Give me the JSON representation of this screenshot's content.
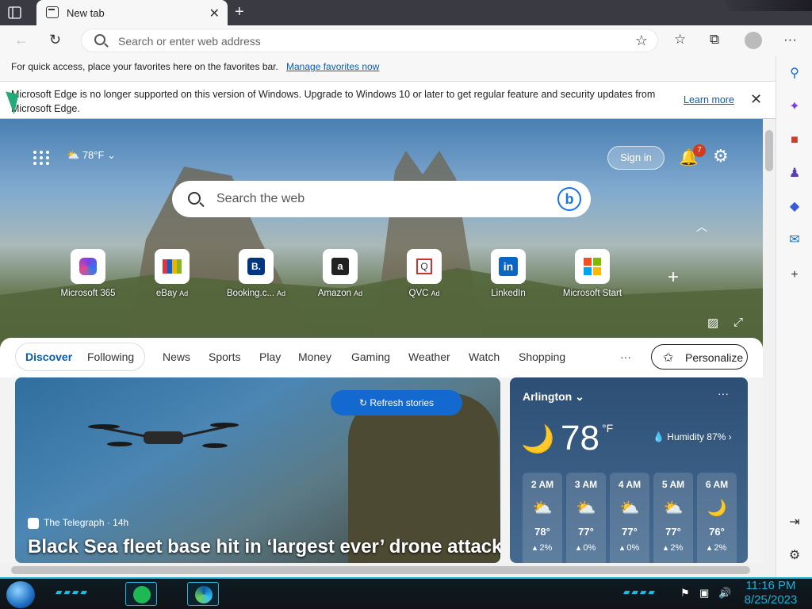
{
  "browser": {
    "tab_title": "New tab",
    "tab_close": "✕",
    "new_tab": "+",
    "address_placeholder": "Search or enter web address"
  },
  "favbar": {
    "text": "For quick access, place your favorites here on the favorites bar.",
    "link": "Manage favorites now"
  },
  "banner": {
    "message": "Microsoft Edge is no longer supported on this version of Windows. Upgrade to Windows 10 or later to get regular feature and security updates from Microsoft Edge.",
    "link": "Learn more"
  },
  "newtab": {
    "weather_small": "78°F",
    "signin": "Sign in",
    "notif_count": "7",
    "search_placeholder": "Search the web",
    "quicklinks": [
      {
        "label": "Microsoft 365",
        "ad": ""
      },
      {
        "label": "eBay",
        "ad": "Ad"
      },
      {
        "label": "Booking.c...",
        "ad": "Ad"
      },
      {
        "label": "Amazon",
        "ad": "Ad"
      },
      {
        "label": "QVC",
        "ad": "Ad"
      },
      {
        "label": "LinkedIn",
        "ad": ""
      },
      {
        "label": "Microsoft Start",
        "ad": ""
      }
    ]
  },
  "feed": {
    "tabs_pill": [
      "Discover",
      "Following"
    ],
    "tabs": [
      "News",
      "Sports",
      "Play",
      "Money",
      "Gaming",
      "Weather",
      "Watch",
      "Shopping"
    ],
    "more": "···",
    "personalize": "Personalize",
    "refresh": "Refresh stories",
    "story": {
      "source": "The Telegraph · 14h",
      "headline": "Black Sea fleet base hit in ‘largest ever’ drone attack"
    },
    "weather": {
      "city": "Arlington",
      "more": "···",
      "temp": "78",
      "unit": "°F",
      "humidity": "Humidity 87%",
      "hours": [
        {
          "h": "2 AM",
          "t": "78°",
          "p": "2%"
        },
        {
          "h": "3 AM",
          "t": "77°",
          "p": "0%"
        },
        {
          "h": "4 AM",
          "t": "77°",
          "p": "0%"
        },
        {
          "h": "5 AM",
          "t": "77°",
          "p": "2%"
        },
        {
          "h": "6 AM",
          "t": "76°",
          "p": "2%"
        }
      ]
    }
  },
  "taskbar": {
    "time": "11:16 PM",
    "date": "8/25/2023"
  },
  "colors": {
    "accent": "#1469d0",
    "link": "#0b5cad",
    "taskbar_accent": "#16b4da"
  }
}
